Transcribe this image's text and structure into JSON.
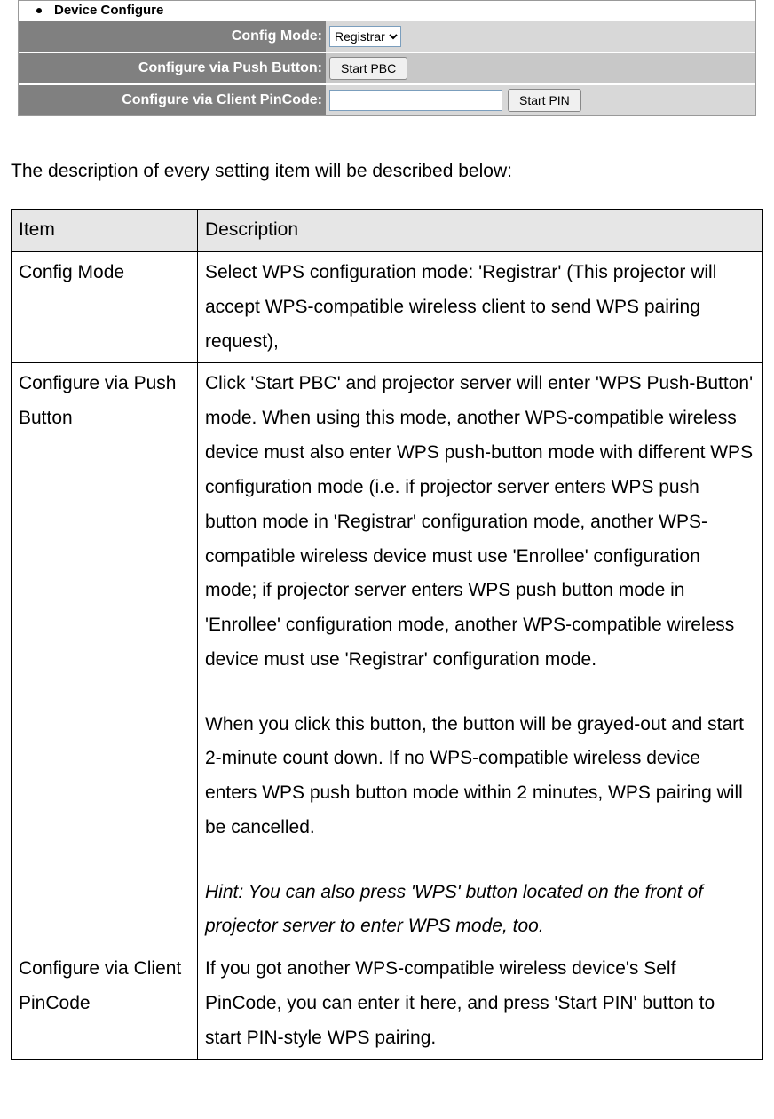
{
  "panel": {
    "title": "Device Configure",
    "rows": [
      {
        "label": "Config Mode:",
        "select_value": "Registrar"
      },
      {
        "label": "Configure via Push Button:",
        "button": "Start PBC"
      },
      {
        "label": "Configure via Client PinCode:",
        "input_value": "",
        "button": "Start PIN"
      }
    ]
  },
  "intro": "The description of every setting item will be described below:",
  "table": {
    "headers": {
      "item": "Item",
      "description": "Description"
    },
    "rows": [
      {
        "item": "Config Mode",
        "desc": "Select WPS configuration mode: 'Registrar' (This projector will accept WPS-compatible wireless client to send WPS pairing request),"
      },
      {
        "item": "Configure via Push Button",
        "desc_p1": "Click 'Start PBC' and projector server will enter 'WPS Push-Button' mode. When using this mode, another WPS-compatible wireless device must also enter WPS push-button mode with different WPS configuration mode (i.e. if projector server enters WPS push button mode in 'Registrar' configuration mode, another WPS-compatible wireless device must use 'Enrollee' configuration mode; if projector server enters WPS push button mode in 'Enrollee' configuration mode, another WPS-compatible wireless device must use 'Registrar' configuration mode.",
        "desc_p2": "When you click this button, the button will be grayed-out and start 2-minute count down. If no WPS-compatible wireless device enters WPS push button mode within 2 minutes, WPS pairing will be cancelled.",
        "desc_hint": "Hint: You can also press 'WPS' button located on the front of projector server to enter WPS mode, too."
      },
      {
        "item": "Configure via Client PinCode",
        "desc": "If you got another WPS-compatible wireless device's Self PinCode, you can enter it here, and press 'Start PIN' button to start PIN-style WPS pairing."
      }
    ]
  }
}
